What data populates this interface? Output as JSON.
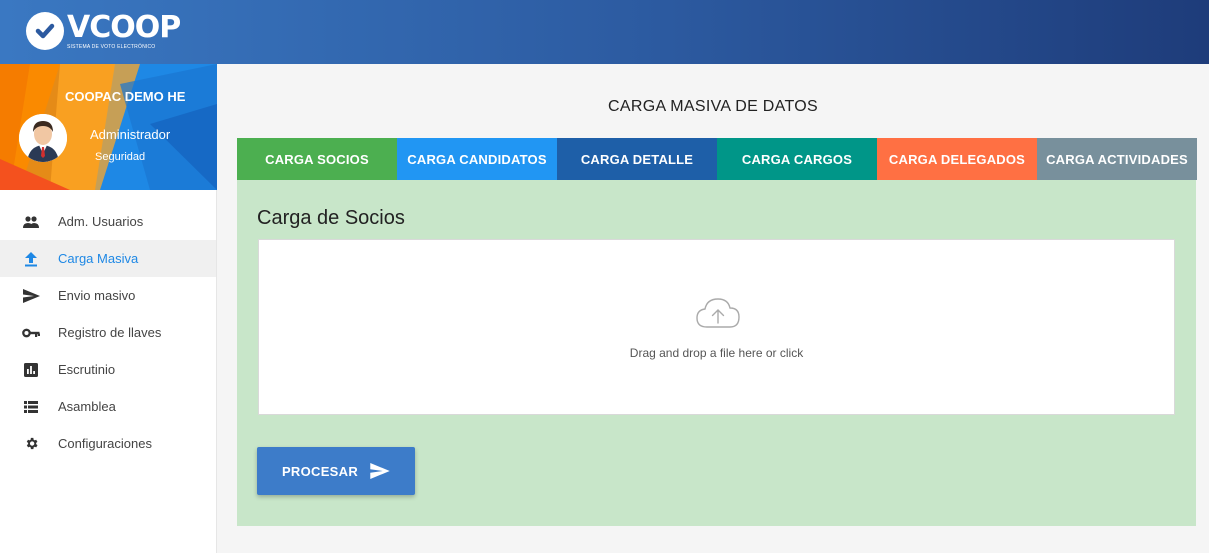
{
  "app": {
    "logo_text": "VCOOP",
    "logo_subtitle": "SISTEMA DE VOTO ELECTRÓNICO"
  },
  "profile": {
    "org_name": "COOPAC DEMO HE",
    "role": "Administrador",
    "department": "Seguridad"
  },
  "menu": {
    "items": [
      {
        "label": "Adm. Usuarios",
        "icon": "people-icon",
        "active": false
      },
      {
        "label": "Carga Masiva",
        "icon": "upload-icon",
        "active": true
      },
      {
        "label": "Envio masivo",
        "icon": "send-icon",
        "active": false
      },
      {
        "label": "Registro de llaves",
        "icon": "key-icon",
        "active": false
      },
      {
        "label": "Escrutinio",
        "icon": "bar-chart-icon",
        "active": false
      },
      {
        "label": "Asamblea",
        "icon": "list-icon",
        "active": false
      },
      {
        "label": "Configuraciones",
        "icon": "gear-icon",
        "active": false
      }
    ]
  },
  "main": {
    "title": "CARGA MASIVA DE DATOS",
    "tabs": [
      {
        "label": "CARGA SOCIOS",
        "color": "#4caf50"
      },
      {
        "label": "CARGA CANDIDATOS",
        "color": "#2196f3"
      },
      {
        "label": "CARGA DETALLE",
        "color": "#1e5fa8"
      },
      {
        "label": "CARGA CARGOS",
        "color": "#009688"
      },
      {
        "label": "CARGA DELEGADOS",
        "color": "#ff7043"
      },
      {
        "label": "CARGA ACTIVIDADES",
        "color": "#78909c"
      }
    ],
    "panel_title": "Carga de Socios",
    "dropzone_text": "Drag and drop a file here or click",
    "process_label": "PROCESAR"
  },
  "colors": {
    "primary": "#1e88e5",
    "panel_bg": "#c8e6c9",
    "process_button": "#3d7cc9"
  }
}
